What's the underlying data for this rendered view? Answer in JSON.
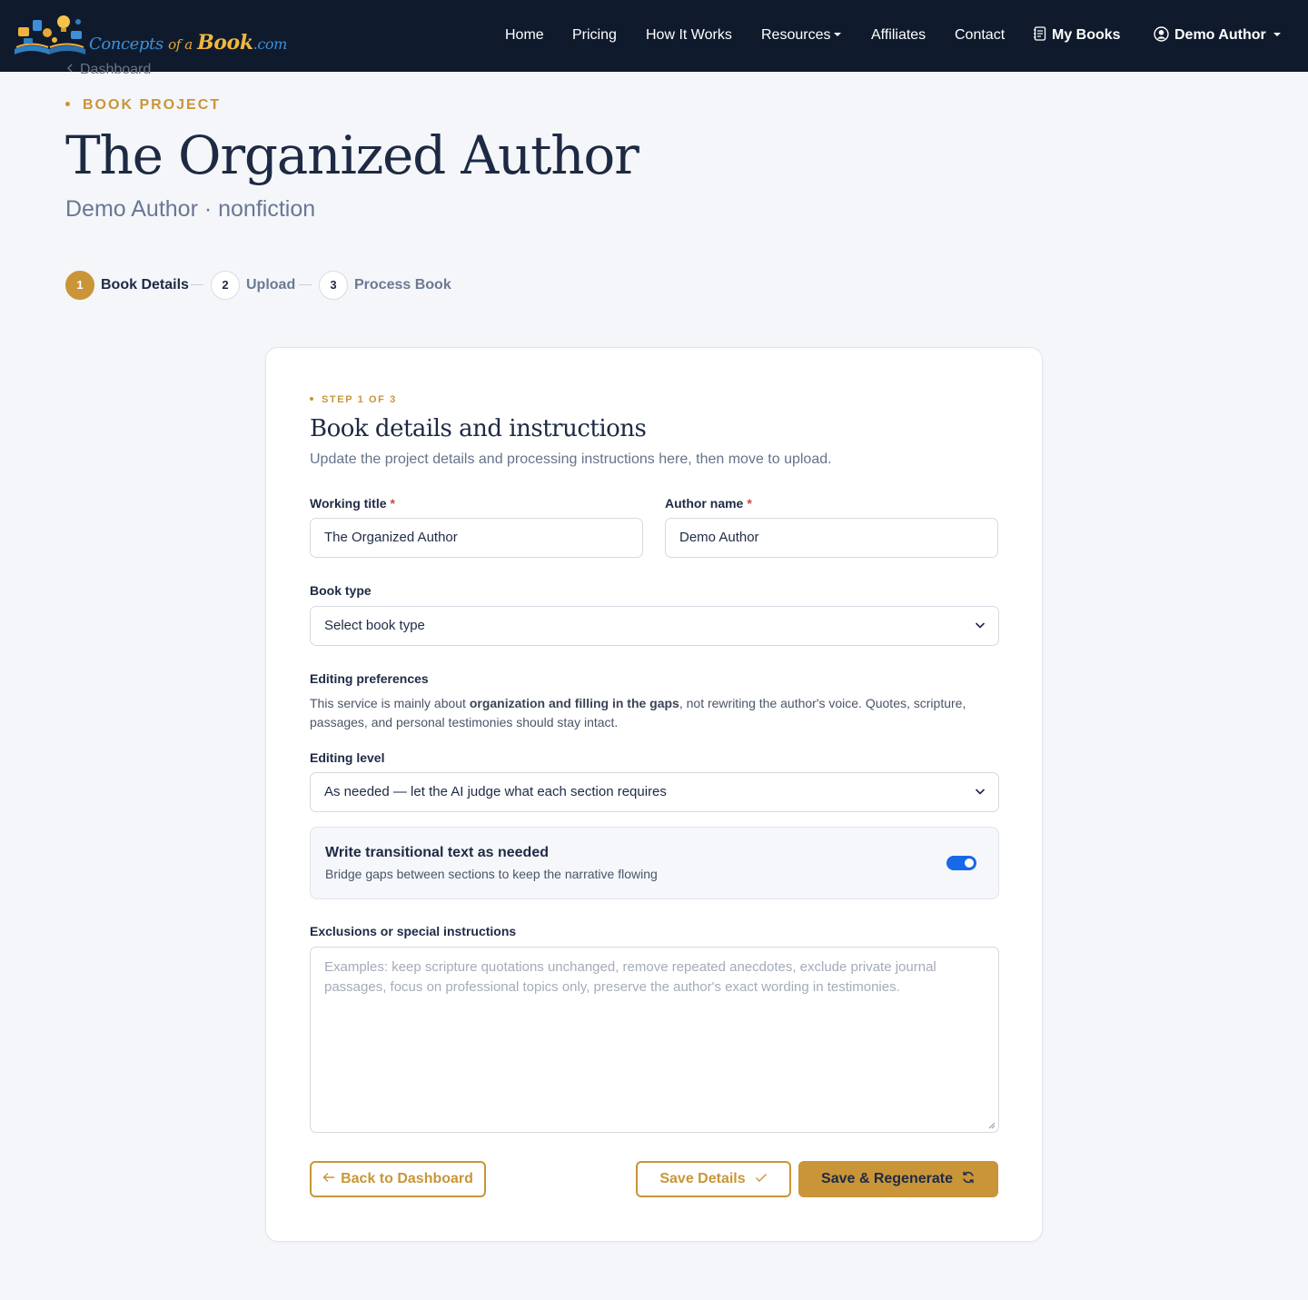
{
  "brand": {
    "parts": [
      "Concepts",
      "of a",
      "Book",
      ".com"
    ]
  },
  "nav": {
    "home": "Home",
    "pricing": "Pricing",
    "how_it_works": "How It Works",
    "resources": "Resources",
    "affiliates": "Affiliates",
    "contact": "Contact",
    "my_books": "My Books",
    "user": "Demo Author"
  },
  "header": {
    "back_link": "Dashboard",
    "eyebrow": "BOOK PROJECT",
    "title": "The Organized Author",
    "subtitle": "Demo Author · nonfiction"
  },
  "stepper": {
    "steps": [
      {
        "number": "1",
        "label": "Book Details",
        "state": "active"
      },
      {
        "number": "2",
        "label": "Upload",
        "state": "idle"
      },
      {
        "number": "3",
        "label": "Process Book",
        "state": "idle"
      }
    ]
  },
  "card": {
    "eyebrow": "STEP 1 OF 3",
    "title": "Book details and instructions",
    "description": "Update the project details and processing instructions here, then move to upload."
  },
  "form": {
    "working_title": {
      "label": "Working title",
      "required": "*",
      "value": "The Organized Author"
    },
    "author_name": {
      "label": "Author name",
      "required": "*",
      "value": "Demo Author"
    },
    "book_type": {
      "label": "Book type",
      "value": "Select book type"
    },
    "editing_preferences": {
      "heading": "Editing preferences",
      "text_before": "This service is mainly about ",
      "text_bold": "organization and filling in the gaps",
      "text_after": ", not rewriting the author's voice. Quotes, scripture, passages, and personal testimonies should stay intact."
    },
    "editing_level": {
      "label": "Editing level",
      "value": "As needed — let the AI judge what each section requires"
    },
    "transitional_toggle": {
      "title": "Write transitional text as needed",
      "description": "Bridge gaps between sections to keep the narrative flowing",
      "enabled": true
    },
    "exclusions": {
      "label": "Exclusions or special instructions",
      "placeholder": "Examples: keep scripture quotations unchanged, remove repeated anecdotes, exclude private journal passages, focus on professional topics only, preserve the author's exact wording in testimonies."
    }
  },
  "actions": {
    "back": "Back to Dashboard",
    "save": "Save Details",
    "save_regenerate": "Save & Regenerate"
  },
  "colors": {
    "navbar_bg": "#0f1b2d",
    "accent_gold": "#c99538",
    "toggle_blue": "#1669e8",
    "page_bg": "#f5f6f9",
    "heading_navy": "#1e2a44"
  }
}
